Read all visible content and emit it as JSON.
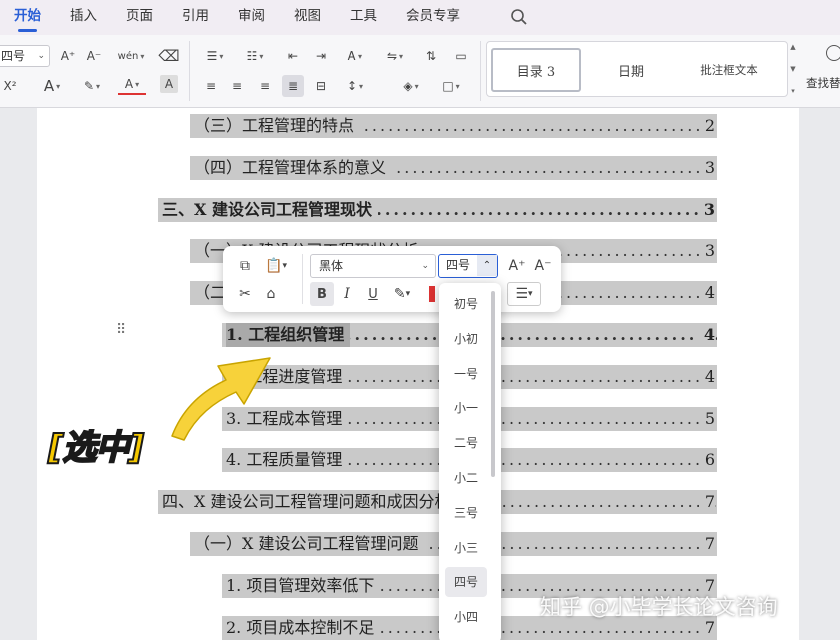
{
  "menu": {
    "tabs": [
      {
        "label": "开始",
        "active": true
      },
      {
        "label": "插入"
      },
      {
        "label": "页面"
      },
      {
        "label": "引用"
      },
      {
        "label": "审阅"
      },
      {
        "label": "视图"
      },
      {
        "label": "工具"
      },
      {
        "label": "会员专享"
      }
    ]
  },
  "ribbon": {
    "font_size_value": "四号",
    "grow_font": "A⁺",
    "shrink_font": "A⁻",
    "pinyin": "wén",
    "superscript": "X²",
    "styles": [
      "目录 3",
      "日期",
      "批注框文本"
    ],
    "find_label": "查找替"
  },
  "document": {
    "toc": [
      {
        "text": "（三）工程管理的特点",
        "page": "2",
        "level": 2
      },
      {
        "text": "（四）工程管理体系的意义",
        "page": "3",
        "level": 2
      },
      {
        "text": "三、X 建设公司工程管理现状",
        "page": "3",
        "level": 1,
        "bold": true
      },
      {
        "text": "（一）X 建设公司工程现状分析",
        "page": "3",
        "level": 2
      },
      {
        "text": "（二）X 建设公司工程管理问题",
        "page": "4",
        "level": 2
      },
      {
        "text": "1. 工程组织管理",
        "page": "4",
        "level": 3,
        "bold": true
      },
      {
        "text": "2. 工程进度管理",
        "page": "4",
        "level": 3
      },
      {
        "text": "3. 工程成本管理",
        "page": "5",
        "level": 3
      },
      {
        "text": "4. 工程质量管理",
        "page": "6",
        "level": 3
      },
      {
        "text": "四、X 建设公司工程管理问题和成因分析",
        "page": "7",
        "level": 1
      },
      {
        "text": "（一）X 建设公司工程管理问题",
        "page": "7",
        "level": 2
      },
      {
        "text": "1. 项目管理效率低下",
        "page": "7",
        "level": 3
      },
      {
        "text": "2. 项目成本控制不足",
        "page": "7",
        "level": 3
      }
    ]
  },
  "mini_toolbar": {
    "font_name": "黑体",
    "font_size": "四号",
    "bold": "B",
    "italic": "I",
    "underline": "U"
  },
  "size_dropdown": {
    "options": [
      "初号",
      "小初",
      "一号",
      "小一",
      "二号",
      "小二",
      "三号",
      "小三",
      "四号",
      "小四"
    ],
    "selected": "四号"
  },
  "annotation": {
    "label": "[选中]",
    "arrow_color": "#f7d23a"
  },
  "watermark": "知乎 @小毕学长论文咨询"
}
